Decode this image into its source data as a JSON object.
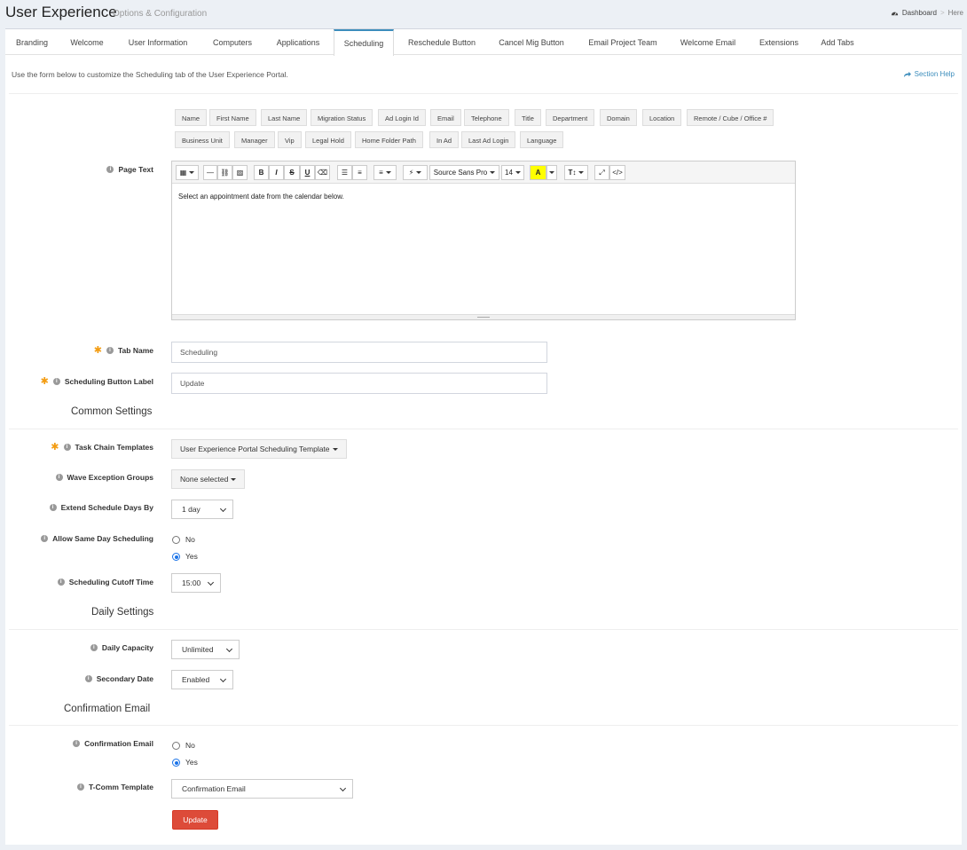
{
  "header": {
    "title": "User Experience",
    "subtitle": "Options & Configuration",
    "breadcrumb": {
      "dashboard": "Dashboard",
      "separator": ">",
      "current": "Here"
    }
  },
  "tabs": [
    "Branding",
    "Welcome",
    "User Information",
    "Computers",
    "Applications",
    "Scheduling",
    "Reschedule Button",
    "Cancel Mig Button",
    "Email Project Team",
    "Welcome Email",
    "Extensions",
    "Add Tabs"
  ],
  "active_tab": "Scheduling",
  "intro": "Use the form below to customize the Scheduling tab of the User Experience Portal.",
  "section_help": "Section Help",
  "placeholders": {
    "row1": [
      "Name",
      "First Name",
      "Last Name",
      "Migration Status",
      "Ad Login Id",
      "Email",
      "Telephone",
      "Title",
      "Department",
      "Domain",
      "Location",
      "Remote / Cube / Office #"
    ],
    "row2": [
      "Business Unit",
      "Manager",
      "Vip",
      "Legal Hold",
      "Home Folder Path",
      "In Ad",
      "Last Ad Login",
      "Language"
    ]
  },
  "page_text": {
    "label": "Page Text",
    "toolbar": {
      "font": "Source Sans Pro",
      "size": "14"
    },
    "content": "Select an appointment date from the calendar below."
  },
  "fields": {
    "tab_name": {
      "label": "Tab Name",
      "value": "Scheduling"
    },
    "button_label": {
      "label": "Scheduling Button Label",
      "value": "Update"
    }
  },
  "common_settings": {
    "title": "Common Settings",
    "task_chain": {
      "label": "Task Chain Templates",
      "value": "User Experience Portal Scheduling Template"
    },
    "wave_exception": {
      "label": "Wave Exception Groups",
      "value": "None selected"
    },
    "extend_days": {
      "label": "Extend Schedule Days By",
      "value": "1 day"
    },
    "same_day": {
      "label": "Allow Same Day Scheduling",
      "options": [
        "No",
        "Yes"
      ],
      "selected": "Yes"
    },
    "cutoff": {
      "label": "Scheduling Cutoff Time",
      "value": "15:00"
    }
  },
  "daily_settings": {
    "title": "Daily Settings",
    "capacity": {
      "label": "Daily Capacity",
      "value": "Unlimited"
    },
    "secondary_date": {
      "label": "Secondary Date",
      "value": "Enabled"
    }
  },
  "confirmation": {
    "title": "Confirmation Email",
    "email": {
      "label": "Confirmation Email",
      "options": [
        "No",
        "Yes"
      ],
      "selected": "Yes"
    },
    "template": {
      "label": "T-Comm Template",
      "value": "Confirmation Email"
    }
  },
  "submit": "Update",
  "colors": {
    "accent": "#3c8dbc",
    "required": "#f39c12",
    "danger": "#dd4b39"
  }
}
